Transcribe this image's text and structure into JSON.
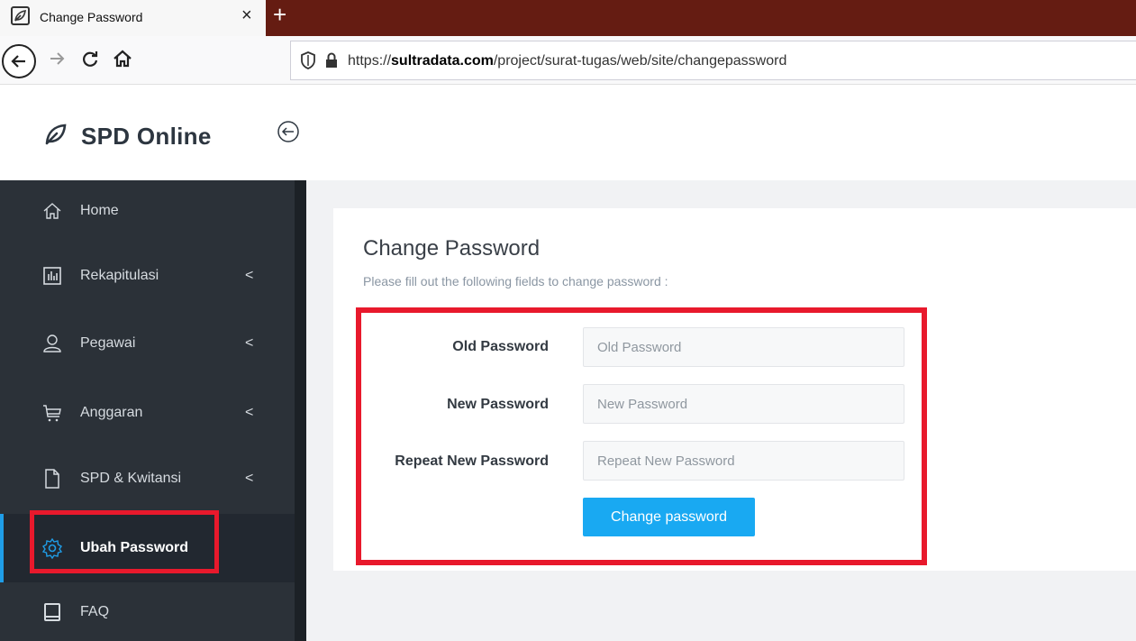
{
  "browser": {
    "tab_title": "Change Password",
    "tab_close": "×",
    "new_tab": "+",
    "url_prefix": "https://",
    "url_domain": "sultradata.com",
    "url_path": "/project/surat-tugas/web/site/changepassword"
  },
  "app": {
    "brand": "SPD Online"
  },
  "sidebar": {
    "items": [
      {
        "label": "Home",
        "icon": "home-icon",
        "has_submenu": false
      },
      {
        "label": "Rekapitulasi",
        "icon": "chart-icon",
        "has_submenu": true
      },
      {
        "label": "Pegawai",
        "icon": "user-icon",
        "has_submenu": true
      },
      {
        "label": "Anggaran",
        "icon": "cart-icon",
        "has_submenu": true
      },
      {
        "label": "SPD & Kwitansi",
        "icon": "document-icon",
        "has_submenu": true
      },
      {
        "label": "Ubah Password",
        "icon": "gear-icon",
        "has_submenu": false,
        "active": true
      },
      {
        "label": "FAQ",
        "icon": "book-icon",
        "has_submenu": false
      }
    ],
    "chevron": "<"
  },
  "form": {
    "title": "Change Password",
    "subtitle": "Please fill out the following fields to change password :",
    "old_label": "Old Password",
    "old_placeholder": "Old Password",
    "new_label": "New Password",
    "new_placeholder": "New Password",
    "repeat_label": "Repeat New Password",
    "repeat_placeholder": "Repeat New Password",
    "submit_label": "Change password"
  },
  "colors": {
    "sidebar_bg": "#2b3138",
    "accent": "#19a9f2",
    "highlight": "#e8192c",
    "tabbar": "#651c12"
  }
}
